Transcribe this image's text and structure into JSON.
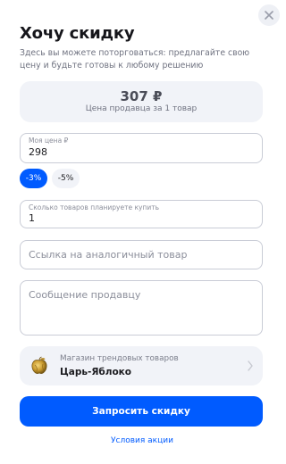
{
  "dialog": {
    "title": "Хочу скидку",
    "subtitle": "Здесь вы можете поторговаться: предлагайте свою цену и будьте готовы к любому решению",
    "close_icon": "close-icon"
  },
  "seller_price": {
    "value": "307 ₽",
    "label": "Цена продавца за 1 товар"
  },
  "my_price": {
    "label": "Моя цена ₽",
    "value": "298"
  },
  "discount_chips": [
    {
      "label": "-3%",
      "selected": true
    },
    {
      "label": "-5%",
      "selected": false
    }
  ],
  "quantity": {
    "label": "Сколько товаров планируете купить",
    "value": "1"
  },
  "similar_link": {
    "placeholder": "Ссылка на аналогичный товар"
  },
  "message": {
    "placeholder": "Сообщение продавцу"
  },
  "shop": {
    "subtitle": "Магазин трендовых товаров",
    "name": "Царь-Яблоко",
    "logo_icon": "golden-apple-icon",
    "arrow_icon": "chevron-right-icon"
  },
  "submit_label": "Запросить скидку",
  "terms_link": "Условия акции",
  "colors": {
    "accent": "#005bff",
    "card_bg": "#f1f3f8",
    "border": "#c9ccd6"
  }
}
